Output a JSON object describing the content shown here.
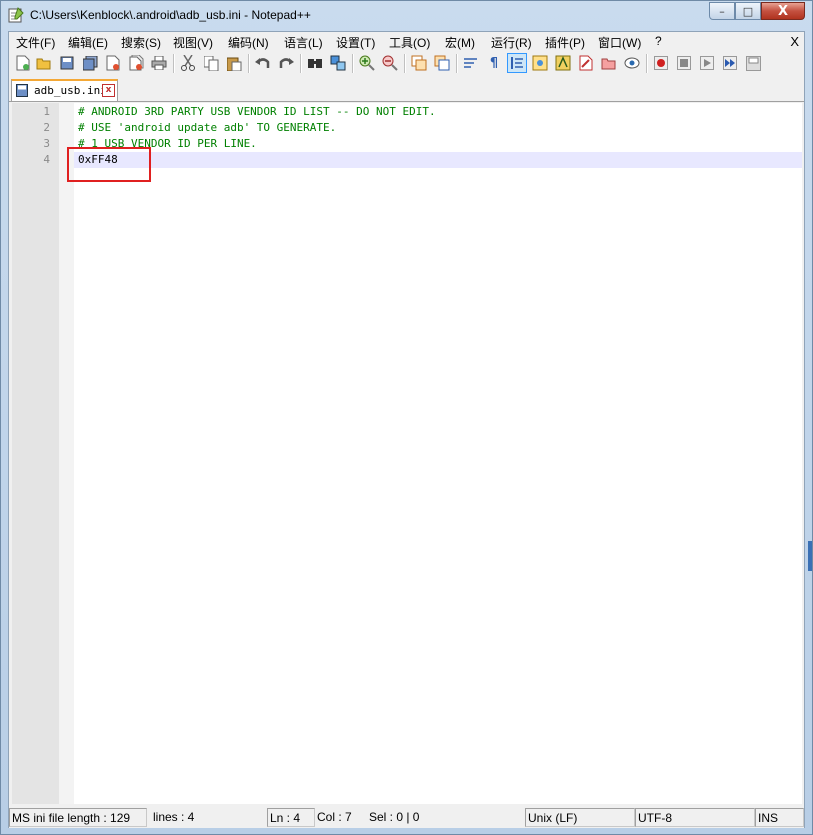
{
  "window": {
    "title": "C:\\Users\\Kenblock\\.android\\adb_usb.ini - Notepad++",
    "buttons": {
      "minimize": "–",
      "maximize": "□",
      "close": "X"
    }
  },
  "menu": {
    "items": [
      "文件(F)",
      "编辑(E)",
      "搜索(S)",
      "视图(V)",
      "编码(N)",
      "语言(L)",
      "设置(T)",
      "工具(O)",
      "宏(M)",
      "运行(R)",
      "插件(P)",
      "窗口(W)",
      "?"
    ],
    "close": "X"
  },
  "toolbar": {
    "icons": [
      "new-file-icon",
      "open-file-icon",
      "save-icon",
      "save-all-icon",
      "close-icon",
      "close-all-icon",
      "print-icon",
      "cut-icon",
      "copy-icon",
      "paste-icon",
      "undo-icon",
      "redo-icon",
      "find-icon",
      "replace-icon",
      "zoom-in-icon",
      "zoom-out-icon",
      "sync-vertical-icon",
      "sync-horizontal-icon",
      "word-wrap-icon",
      "show-all-chars-icon",
      "indent-guide-icon",
      "doc-map-icon",
      "function-list-icon",
      "folder-as-workspace-icon",
      "monitoring-icon",
      "record-macro-icon",
      "stop-macro-icon",
      "play-macro-icon",
      "run-macro-multiple-icon",
      "save-macro-icon"
    ]
  },
  "tab": {
    "label": "adb_usb.ini",
    "close": "x"
  },
  "editor": {
    "lines": [
      {
        "num": "1",
        "text": "# ANDROID 3RD PARTY USB VENDOR ID LIST -- DO NOT EDIT."
      },
      {
        "num": "2",
        "text": "# USE 'android update adb' TO GENERATE."
      },
      {
        "num": "3",
        "text": "# 1 USB VENDOR ID PER LINE."
      },
      {
        "num": "4",
        "text": "0xFF48"
      }
    ],
    "current_line": 4,
    "highlight_color": "#e02020",
    "comment_color": "#008000"
  },
  "status": {
    "file_info": "MS ini file length : 129",
    "lines": "lines : 4",
    "ln": "Ln : 4",
    "col": "Col : 7",
    "sel": "Sel : 0 | 0",
    "eol": "Unix (LF)",
    "encoding": "UTF-8",
    "mode": "INS"
  }
}
